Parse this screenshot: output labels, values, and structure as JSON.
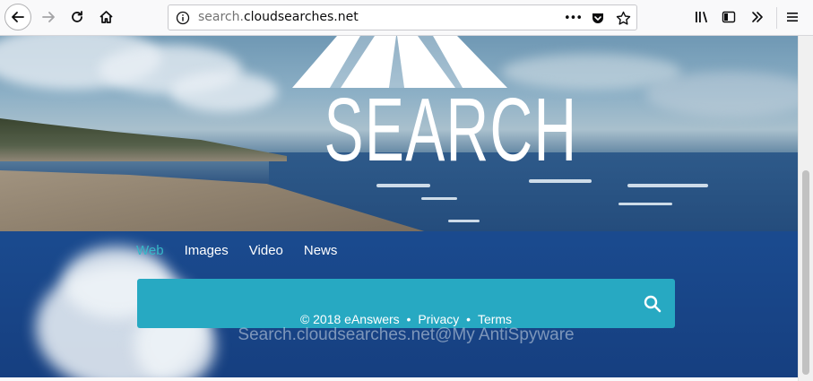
{
  "browser": {
    "url_prefix": "search.",
    "url_host": "cloudsearches.net",
    "overflow_label": "•••",
    "icons": {
      "back": "back-arrow-icon",
      "forward": "forward-arrow-icon",
      "reload": "reload-icon",
      "home": "home-icon",
      "info": "info-icon",
      "pocket": "pocket-icon",
      "bookmark": "star-icon",
      "library": "library-icon",
      "sidebar": "sidebar-icon",
      "overflow": "chevrons-right-icon",
      "menu": "hamburger-menu-icon"
    }
  },
  "logo": {
    "text": "SEARCH"
  },
  "nav": [
    {
      "label": "Web",
      "active": true
    },
    {
      "label": "Images",
      "active": false
    },
    {
      "label": "Video",
      "active": false
    },
    {
      "label": "News",
      "active": false
    }
  ],
  "search": {
    "placeholder": "",
    "button_icon": "search-icon"
  },
  "footer": {
    "copyright": "© 2018 eAnswers",
    "privacy": "Privacy",
    "terms": "Terms",
    "separator": "•"
  },
  "watermark": "Search.cloudsearches.net@My AntiSpyware",
  "colors": {
    "accent": "#27a9c2",
    "nav_active": "#35b8c9",
    "page_bg": "#1b4f91"
  }
}
